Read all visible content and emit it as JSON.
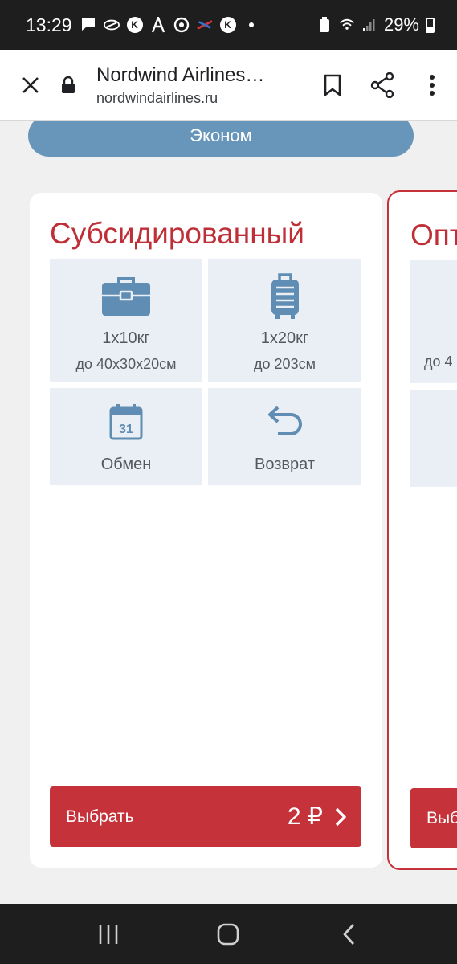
{
  "status_bar": {
    "time": "13:29",
    "battery": "29%"
  },
  "browser": {
    "title": "Nordwind Airlines…",
    "domain": "nordwindairlines.ru"
  },
  "fare_class": "Эконом",
  "tariffs": [
    {
      "title": "Субсидированный",
      "features": [
        {
          "icon": "briefcase-icon",
          "main": "1х10кг",
          "sub": "до 40х30х20см"
        },
        {
          "icon": "suitcase-icon",
          "main": "1х20кг",
          "sub": "до 203см"
        },
        {
          "icon": "calendar-icon",
          "icon_text": "31",
          "main": "Обмен"
        },
        {
          "icon": "return-arrow-icon",
          "main": "Возврат"
        }
      ],
      "select_label": "Выбрать",
      "price": "2 ₽"
    },
    {
      "title": "Опт",
      "feature_sub": "до 4",
      "select_label": "Выб"
    }
  ],
  "colors": {
    "accent_red": "#c6323a",
    "economy_blue": "#6896ba",
    "icon_blue": "#5f8db3",
    "tile_bg": "#eaeff6"
  }
}
